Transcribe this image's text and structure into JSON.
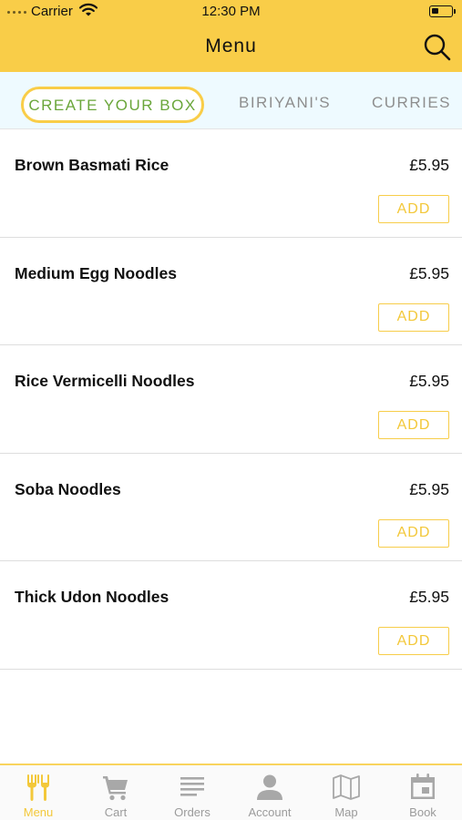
{
  "status_bar": {
    "carrier": "Carrier",
    "time": "12:30 PM"
  },
  "header": {
    "title": "Menu"
  },
  "tabs": [
    {
      "label": "CREATE YOUR BOX",
      "active": true
    },
    {
      "label": "BIRIYANI'S",
      "active": false
    },
    {
      "label": "CURRIES",
      "active": false
    }
  ],
  "items": [
    {
      "name": "Brown Basmati Rice",
      "price": "£5.95",
      "button": "ADD"
    },
    {
      "name": "Medium Egg Noodles",
      "price": "£5.95",
      "button": "ADD"
    },
    {
      "name": "Rice Vermicelli Noodles",
      "price": "£5.95",
      "button": "ADD"
    },
    {
      "name": "Soba Noodles",
      "price": "£5.95",
      "button": "ADD"
    },
    {
      "name": "Thick Udon Noodles",
      "price": "£5.95",
      "button": "ADD"
    }
  ],
  "bottom_nav": [
    {
      "label": "Menu",
      "icon": "fork-knife-icon",
      "active": true
    },
    {
      "label": "Cart",
      "icon": "cart-icon",
      "active": false
    },
    {
      "label": "Orders",
      "icon": "list-icon",
      "active": false
    },
    {
      "label": "Account",
      "icon": "person-icon",
      "active": false
    },
    {
      "label": "Map",
      "icon": "map-icon",
      "active": false
    },
    {
      "label": "Book",
      "icon": "calendar-icon",
      "active": false
    }
  ],
  "colors": {
    "accent": "#f9cd48",
    "active_tab_text": "#6aa63a",
    "tab_bg": "#eefaff",
    "inactive": "#9b9b9b"
  }
}
